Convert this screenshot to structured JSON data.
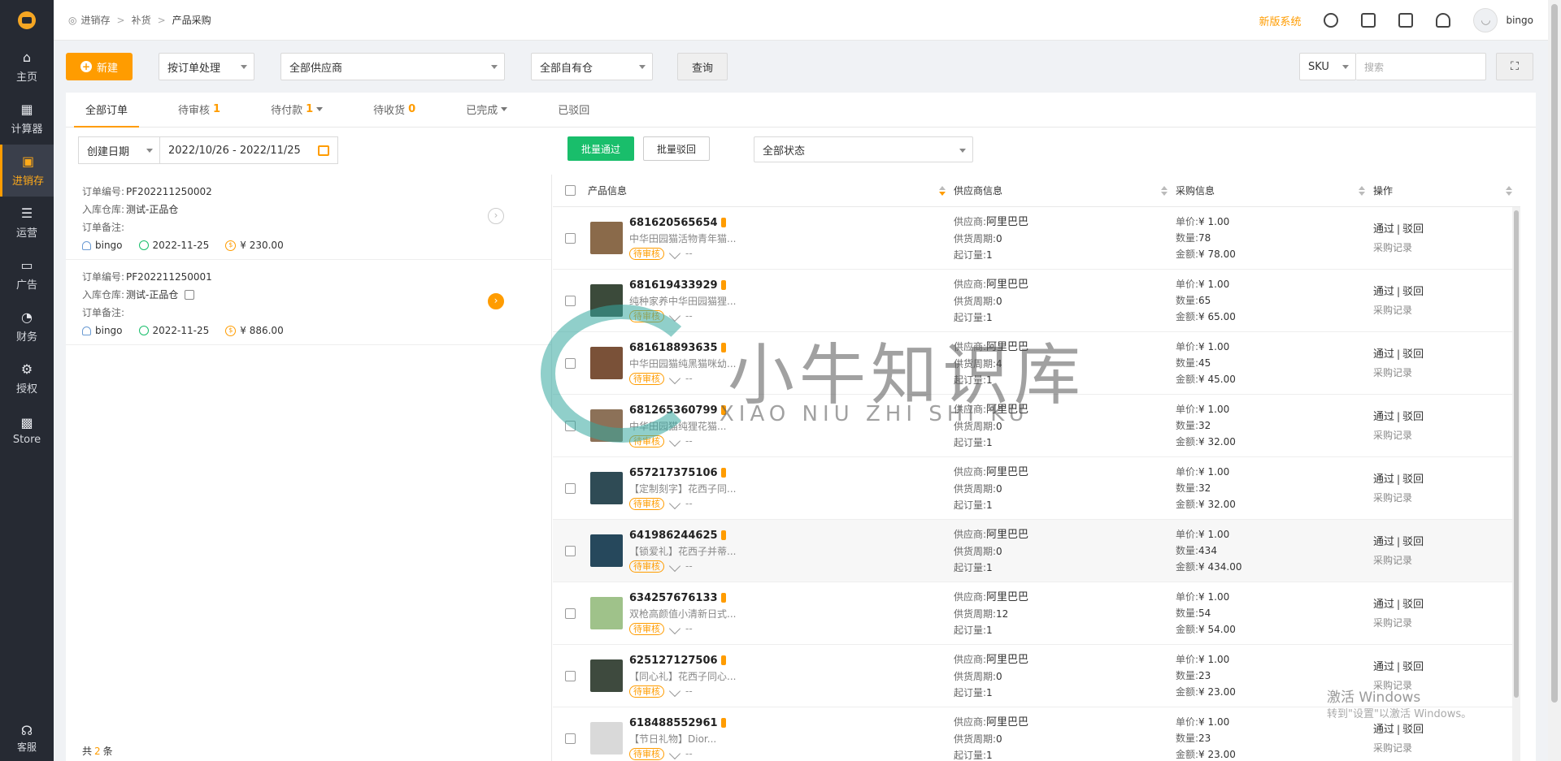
{
  "sidebar": {
    "items": [
      {
        "label": "主页",
        "icon": "home-icon"
      },
      {
        "label": "计算器",
        "icon": "calculator-icon"
      },
      {
        "label": "进销存",
        "icon": "inventory-icon",
        "active": true
      },
      {
        "label": "运营",
        "icon": "operations-icon"
      },
      {
        "label": "广告",
        "icon": "ads-icon"
      },
      {
        "label": "财务",
        "icon": "finance-icon"
      },
      {
        "label": "授权",
        "icon": "gear-icon"
      },
      {
        "label": "Store",
        "icon": "grid-icon"
      }
    ],
    "bottom": {
      "label": "客服",
      "icon": "headset-icon"
    }
  },
  "breadcrumb": [
    "进销存",
    "补货",
    "产品采购"
  ],
  "topbar": {
    "new_system": "新版系统",
    "username": "bingo"
  },
  "toolbar": {
    "new_label": "新建",
    "process_mode": "按订单处理",
    "supplier": "全部供应商",
    "warehouse": "全部自有仓",
    "query_label": "查询",
    "search_field": "SKU",
    "search_placeholder": "搜索"
  },
  "tabs": [
    {
      "label": "全部订单",
      "count": ""
    },
    {
      "label": "待审核",
      "count": "1"
    },
    {
      "label": "待付款",
      "count": "1"
    },
    {
      "label": "待收货",
      "count": "0"
    },
    {
      "label": "已完成",
      "count": ""
    },
    {
      "label": "已驳回",
      "count": ""
    }
  ],
  "filter": {
    "date_type": "创建日期",
    "date_range": "2022/10/26 - 2022/11/25",
    "batch_pass": "批量通过",
    "batch_reject": "批量驳回",
    "status": "全部状态"
  },
  "orders": [
    {
      "no_label": "订单编号:",
      "no": "PF202211250002",
      "wh_label": "入库仓库:",
      "wh": "测试-正品仓",
      "note_label": "订单备注:",
      "user": "bingo",
      "date": "2022-11-25",
      "amount": "¥ 230.00"
    },
    {
      "no_label": "订单编号:",
      "no": "PF202211250001",
      "wh_label": "入库仓库:",
      "wh": "测试-正品仓",
      "note_label": "订单备注:",
      "user": "bingo",
      "date": "2022-11-25",
      "amount": "¥ 886.00"
    }
  ],
  "order_footer": {
    "prefix": "共",
    "count": "2",
    "suffix": "条"
  },
  "table": {
    "headers": [
      "产品信息",
      "供应商信息",
      "采购信息",
      "操作"
    ],
    "rows": [
      {
        "sku": "681620565654",
        "title": "中华田园猫活物青年猫...",
        "tag": "待审核",
        "dash": "--",
        "supplier_label": "供应商:",
        "supplier": "阿里巴巴",
        "cycle_label": "供货周期:",
        "cycle": "0",
        "moq_label": "起订量:",
        "moq": "1",
        "price_label": "单价:",
        "price": "¥ 1.00",
        "qty_label": "数量:",
        "qty": "78",
        "amount_label": "金额:",
        "amount": "¥ 78.00",
        "pass": "通过",
        "reject": "驳回",
        "record": "采购记录",
        "thumb": "#8a6a4a"
      },
      {
        "sku": "681619433929",
        "title": "纯种家养中华田园猫狸...",
        "tag": "待审核",
        "dash": "--",
        "supplier_label": "供应商:",
        "supplier": "阿里巴巴",
        "cycle_label": "供货周期:",
        "cycle": "0",
        "moq_label": "起订量:",
        "moq": "1",
        "price_label": "单价:",
        "price": "¥ 1.00",
        "qty_label": "数量:",
        "qty": "65",
        "amount_label": "金额:",
        "amount": "¥ 65.00",
        "pass": "通过",
        "reject": "驳回",
        "record": "采购记录",
        "thumb": "#3b4a3a"
      },
      {
        "sku": "681618893635",
        "title": "中华田园猫纯黑猫咪幼...",
        "tag": "待审核",
        "dash": "--",
        "supplier_label": "供应商:",
        "supplier": "阿里巴巴",
        "cycle_label": "供货周期:",
        "cycle": "4",
        "moq_label": "起订量:",
        "moq": "1",
        "price_label": "单价:",
        "price": "¥ 1.00",
        "qty_label": "数量:",
        "qty": "45",
        "amount_label": "金额:",
        "amount": "¥ 45.00",
        "pass": "通过",
        "reject": "驳回",
        "record": "采购记录",
        "thumb": "#7a5138"
      },
      {
        "sku": "681265360799",
        "title": "中华田园猫纯狸花猫...",
        "tag": "待审核",
        "dash": "--",
        "supplier_label": "供应商:",
        "supplier": "阿里巴巴",
        "cycle_label": "供货周期:",
        "cycle": "0",
        "moq_label": "起订量:",
        "moq": "1",
        "price_label": "单价:",
        "price": "¥ 1.00",
        "qty_label": "数量:",
        "qty": "32",
        "amount_label": "金额:",
        "amount": "¥ 32.00",
        "pass": "通过",
        "reject": "驳回",
        "record": "采购记录",
        "thumb": "#8c7158"
      },
      {
        "sku": "657217375106",
        "title": "【定制刻字】花西子同...",
        "tag": "待审核",
        "dash": "--",
        "supplier_label": "供应商:",
        "supplier": "阿里巴巴",
        "cycle_label": "供货周期:",
        "cycle": "0",
        "moq_label": "起订量:",
        "moq": "1",
        "price_label": "单价:",
        "price": "¥ 1.00",
        "qty_label": "数量:",
        "qty": "32",
        "amount_label": "金额:",
        "amount": "¥ 32.00",
        "pass": "通过",
        "reject": "驳回",
        "record": "采购记录",
        "thumb": "#2f4b55"
      },
      {
        "sku": "641986244625",
        "title": "【锁爱礼】花西子并蒂...",
        "tag": "待审核",
        "dash": "--",
        "supplier_label": "供应商:",
        "supplier": "阿里巴巴",
        "cycle_label": "供货周期:",
        "cycle": "0",
        "moq_label": "起订量:",
        "moq": "1",
        "price_label": "单价:",
        "price": "¥ 1.00",
        "qty_label": "数量:",
        "qty": "434",
        "amount_label": "金额:",
        "amount": "¥ 434.00",
        "pass": "通过",
        "reject": "驳回",
        "record": "采购记录",
        "thumb": "#26485c",
        "hl": true
      },
      {
        "sku": "634257676133",
        "title": "双枪高颜值小清新日式...",
        "tag": "待审核",
        "dash": "--",
        "supplier_label": "供应商:",
        "supplier": "阿里巴巴",
        "cycle_label": "供货周期:",
        "cycle": "12",
        "moq_label": "起订量:",
        "moq": "1",
        "price_label": "单价:",
        "price": "¥ 1.00",
        "qty_label": "数量:",
        "qty": "54",
        "amount_label": "金额:",
        "amount": "¥ 54.00",
        "pass": "通过",
        "reject": "驳回",
        "record": "采购记录",
        "thumb": "#9fc28a"
      },
      {
        "sku": "625127127506",
        "title": "【同心礼】花西子同心...",
        "tag": "待审核",
        "dash": "--",
        "supplier_label": "供应商:",
        "supplier": "阿里巴巴",
        "cycle_label": "供货周期:",
        "cycle": "0",
        "moq_label": "起订量:",
        "moq": "1",
        "price_label": "单价:",
        "price": "¥ 1.00",
        "qty_label": "数量:",
        "qty": "23",
        "amount_label": "金额:",
        "amount": "¥ 23.00",
        "pass": "通过",
        "reject": "驳回",
        "record": "采购记录",
        "thumb": "#3e4a3e"
      },
      {
        "sku": "618488552961",
        "title": "【节日礼物】Dior...",
        "tag": "待审核",
        "dash": "--",
        "supplier_label": "供应商:",
        "supplier": "阿里巴巴",
        "cycle_label": "供货周期:",
        "cycle": "0",
        "moq_label": "起订量:",
        "moq": "1",
        "price_label": "单价:",
        "price": "¥ 1.00",
        "qty_label": "数量:",
        "qty": "23",
        "amount_label": "金额:",
        "amount": "¥ 23.00",
        "pass": "通过",
        "reject": "驳回",
        "record": "采购记录",
        "thumb": "#d9d9d9"
      }
    ]
  },
  "watermark": {
    "cn": "小牛知识库",
    "en": "XIAO NIU ZHI SHI KU"
  },
  "windows_activation": {
    "line1": "激活 Windows",
    "line2": "转到\"设置\"以激活 Windows。"
  }
}
